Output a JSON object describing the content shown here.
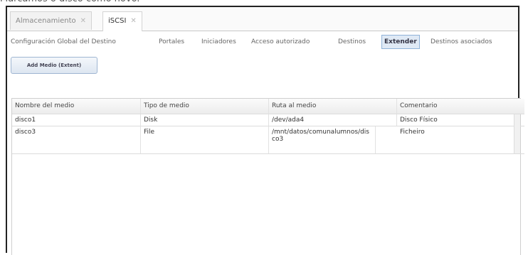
{
  "caption": "Marcamos o disco como novo.",
  "tabs": [
    {
      "label": "Almacenamiento",
      "close": "✕"
    },
    {
      "label": "iSCSI",
      "close": "✕"
    }
  ],
  "subnav": {
    "items": [
      "Configuración Global del Destino",
      "Portales",
      "Iniciadores",
      "Acceso autorizado",
      "Destinos",
      "Extender",
      "Destinos asociados"
    ],
    "active": "Extender"
  },
  "add_button": "Add Medio (Extent)",
  "table": {
    "columns": [
      "Nombre del medio",
      "Tipo de medio",
      "Ruta al medio",
      "Comentario"
    ],
    "rows": [
      [
        "disco1",
        "Disk",
        "/dev/ada4",
        "Disco Físico"
      ],
      [
        "disco3",
        "File",
        "/mnt/datos/comunalumnos/disco3",
        "Ficheiro"
      ]
    ]
  }
}
